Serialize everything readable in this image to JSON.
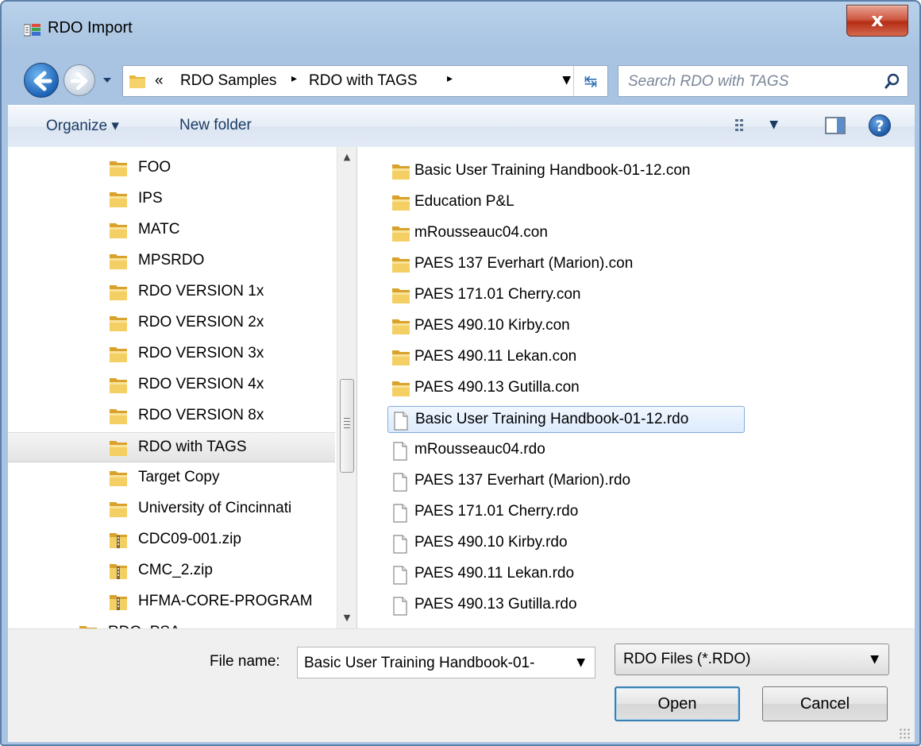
{
  "window": {
    "title": "RDO Import",
    "close_label": "x"
  },
  "address": {
    "overflow": "«",
    "crumbs": [
      "RDO Samples",
      "RDO with TAGS"
    ],
    "separator": "▸"
  },
  "search": {
    "placeholder": "Search RDO with TAGS"
  },
  "toolbar": {
    "organize_label": "Organize ▾",
    "new_folder_label": "New folder"
  },
  "nav_tree": {
    "items": [
      {
        "label": "FOO",
        "type": "folder"
      },
      {
        "label": "IPS",
        "type": "folder"
      },
      {
        "label": "MATC",
        "type": "folder"
      },
      {
        "label": "MPSRDO",
        "type": "folder"
      },
      {
        "label": "RDO VERSION 1x",
        "type": "folder"
      },
      {
        "label": "RDO VERSION 2x",
        "type": "folder"
      },
      {
        "label": "RDO VERSION 3x",
        "type": "folder"
      },
      {
        "label": "RDO VERSION 4x",
        "type": "folder"
      },
      {
        "label": "RDO VERSION 8x",
        "type": "folder"
      },
      {
        "label": "RDO with TAGS",
        "type": "folder",
        "selected": true
      },
      {
        "label": "Target Copy",
        "type": "folder"
      },
      {
        "label": "University of Cincinnati",
        "type": "folder"
      },
      {
        "label": "CDC09-001.zip",
        "type": "zip"
      },
      {
        "label": "CMC_2.zip",
        "type": "zip"
      },
      {
        "label": "HFMA-CORE-PROGRAM",
        "type": "zip"
      },
      {
        "label": "RDO_PSA",
        "type": "folder"
      }
    ]
  },
  "files": {
    "items": [
      {
        "label": "Basic User Training Handbook-01-12.con",
        "type": "folder"
      },
      {
        "label": "Education P&L",
        "type": "folder"
      },
      {
        "label": "mRousseauc04.con",
        "type": "folder"
      },
      {
        "label": "PAES 137 Everhart (Marion).con",
        "type": "folder"
      },
      {
        "label": "PAES 171.01 Cherry.con",
        "type": "folder"
      },
      {
        "label": "PAES 490.10 Kirby.con",
        "type": "folder"
      },
      {
        "label": "PAES 490.11 Lekan.con",
        "type": "folder"
      },
      {
        "label": "PAES 490.13 Gutilla.con",
        "type": "folder"
      },
      {
        "label": "Basic User Training Handbook-01-12.rdo",
        "type": "file",
        "selected": true
      },
      {
        "label": "mRousseauc04.rdo",
        "type": "file"
      },
      {
        "label": "PAES 137 Everhart (Marion).rdo",
        "type": "file"
      },
      {
        "label": "PAES 171.01 Cherry.rdo",
        "type": "file"
      },
      {
        "label": "PAES 490.10 Kirby.rdo",
        "type": "file"
      },
      {
        "label": "PAES 490.11 Lekan.rdo",
        "type": "file"
      },
      {
        "label": "PAES 490.13 Gutilla.rdo",
        "type": "file"
      }
    ]
  },
  "bottom": {
    "file_name_label": "File name:",
    "file_name_value": "Basic User Training Handbook-01-",
    "file_type_value": "RDO Files (*.RDO)",
    "open_label": "Open",
    "cancel_label": "Cancel"
  },
  "colors": {
    "accent": "#1e63b5",
    "selection_border": "#84acdd",
    "close_red": "#c4452c"
  }
}
